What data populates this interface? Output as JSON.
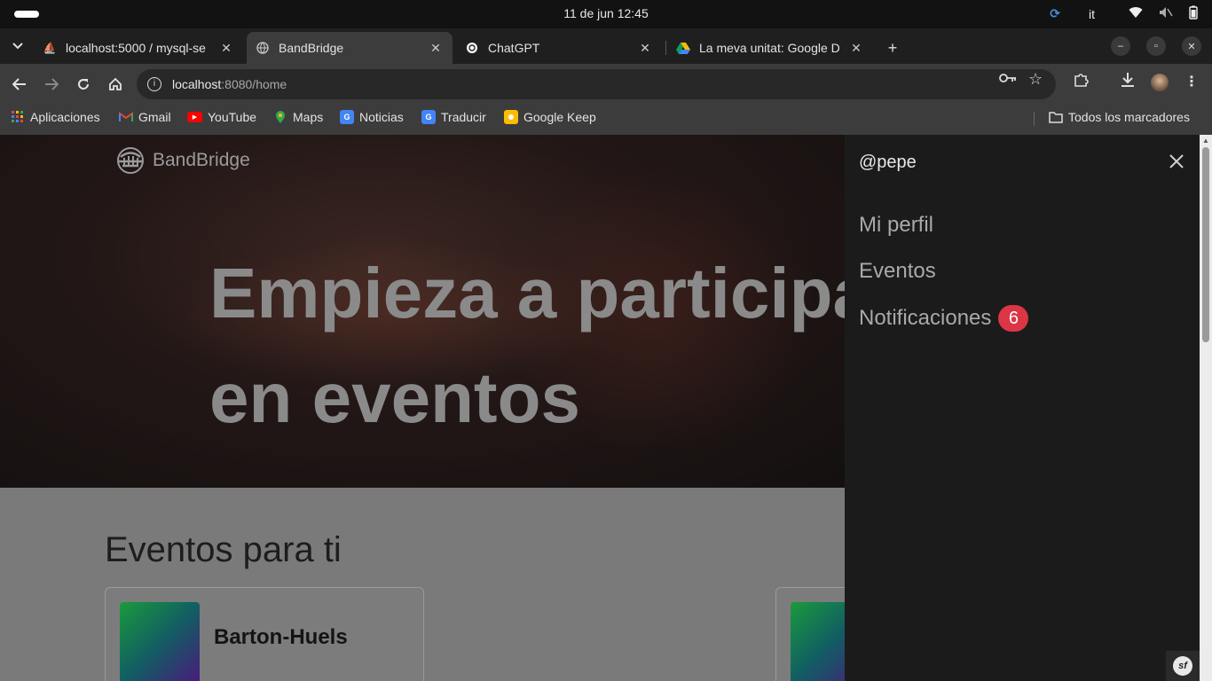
{
  "system": {
    "clock": "11 de jun  12:45",
    "language": "it"
  },
  "tabs": [
    {
      "title": "localhost:5000 / mysql-se",
      "icon": "phpmyadmin-icon"
    },
    {
      "title": "BandBridge",
      "icon": "globe-icon"
    },
    {
      "title": "ChatGPT",
      "icon": "chatgpt-icon"
    },
    {
      "title": "La meva unitat: Google D",
      "icon": "google-drive-icon"
    }
  ],
  "address": {
    "host": "localhost",
    "path": ":8080/home"
  },
  "bookmarks": {
    "items": [
      {
        "label": "Aplicaciones",
        "icon": "apps-grid-icon"
      },
      {
        "label": "Gmail",
        "icon": "gmail-icon"
      },
      {
        "label": "YouTube",
        "icon": "youtube-icon"
      },
      {
        "label": "Maps",
        "icon": "maps-icon"
      },
      {
        "label": "Noticias",
        "icon": "news-icon"
      },
      {
        "label": "Traducir",
        "icon": "translate-icon"
      },
      {
        "label": "Google Keep",
        "icon": "keep-icon"
      }
    ],
    "all": "Todos los marcadores"
  },
  "site": {
    "brand": "BandBridge",
    "hero_line1": "Empieza a participar",
    "hero_line2": "en eventos",
    "section_title": "Eventos para ti",
    "cards": [
      {
        "name": "Barton-Huels"
      },
      {
        "name": ""
      }
    ]
  },
  "drawer": {
    "username": "@pepe",
    "menu": [
      {
        "label": "Mi perfil"
      },
      {
        "label": "Eventos"
      },
      {
        "label": "Notificaciones",
        "badge": "6"
      }
    ]
  },
  "colors": {
    "badge": "#dc3545",
    "drawer_bg": "#1b1b1b"
  }
}
